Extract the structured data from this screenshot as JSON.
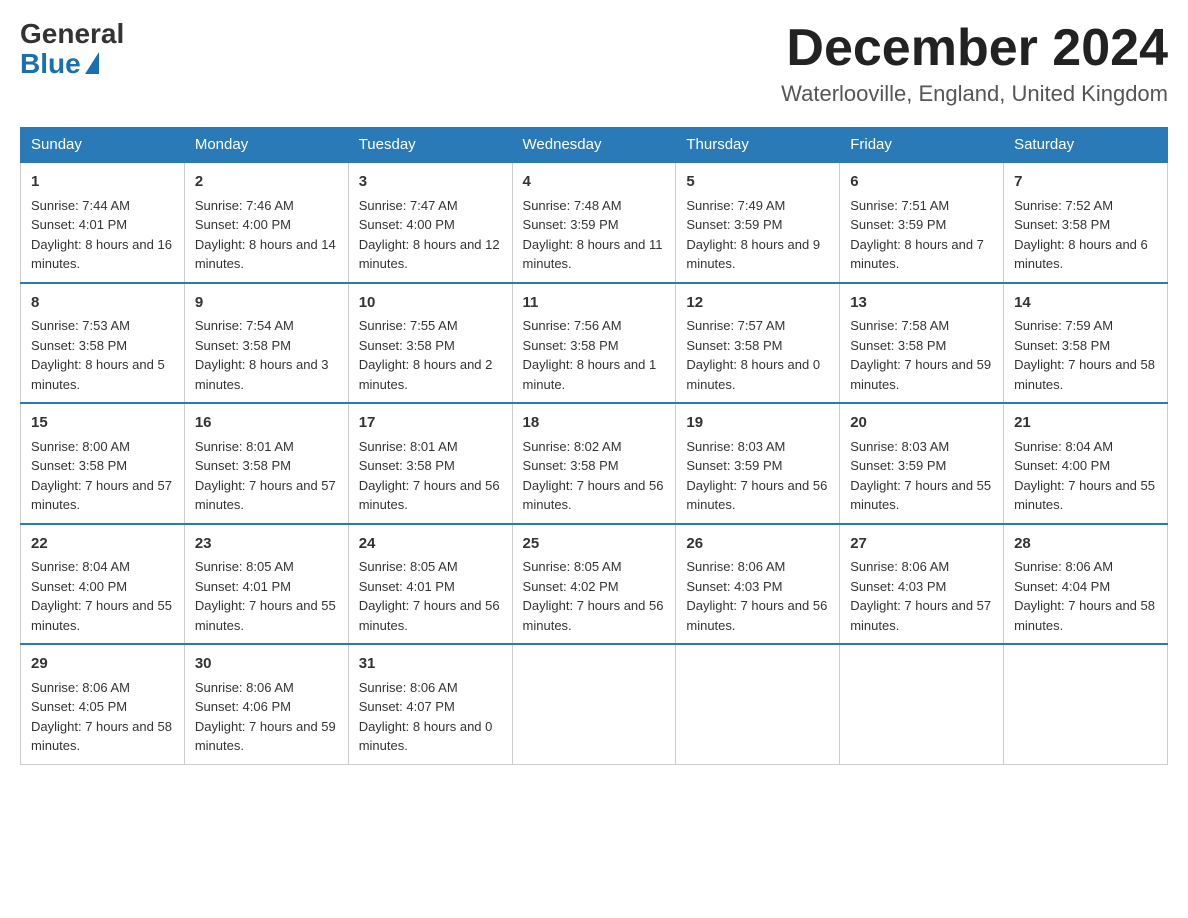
{
  "logo": {
    "general": "General",
    "blue": "Blue"
  },
  "header": {
    "month_year": "December 2024",
    "location": "Waterlooville, England, United Kingdom"
  },
  "days_of_week": [
    "Sunday",
    "Monday",
    "Tuesday",
    "Wednesday",
    "Thursday",
    "Friday",
    "Saturday"
  ],
  "weeks": [
    [
      {
        "day": "1",
        "sunrise": "7:44 AM",
        "sunset": "4:01 PM",
        "daylight": "8 hours and 16 minutes."
      },
      {
        "day": "2",
        "sunrise": "7:46 AM",
        "sunset": "4:00 PM",
        "daylight": "8 hours and 14 minutes."
      },
      {
        "day": "3",
        "sunrise": "7:47 AM",
        "sunset": "4:00 PM",
        "daylight": "8 hours and 12 minutes."
      },
      {
        "day": "4",
        "sunrise": "7:48 AM",
        "sunset": "3:59 PM",
        "daylight": "8 hours and 11 minutes."
      },
      {
        "day": "5",
        "sunrise": "7:49 AM",
        "sunset": "3:59 PM",
        "daylight": "8 hours and 9 minutes."
      },
      {
        "day": "6",
        "sunrise": "7:51 AM",
        "sunset": "3:59 PM",
        "daylight": "8 hours and 7 minutes."
      },
      {
        "day": "7",
        "sunrise": "7:52 AM",
        "sunset": "3:58 PM",
        "daylight": "8 hours and 6 minutes."
      }
    ],
    [
      {
        "day": "8",
        "sunrise": "7:53 AM",
        "sunset": "3:58 PM",
        "daylight": "8 hours and 5 minutes."
      },
      {
        "day": "9",
        "sunrise": "7:54 AM",
        "sunset": "3:58 PM",
        "daylight": "8 hours and 3 minutes."
      },
      {
        "day": "10",
        "sunrise": "7:55 AM",
        "sunset": "3:58 PM",
        "daylight": "8 hours and 2 minutes."
      },
      {
        "day": "11",
        "sunrise": "7:56 AM",
        "sunset": "3:58 PM",
        "daylight": "8 hours and 1 minute."
      },
      {
        "day": "12",
        "sunrise": "7:57 AM",
        "sunset": "3:58 PM",
        "daylight": "8 hours and 0 minutes."
      },
      {
        "day": "13",
        "sunrise": "7:58 AM",
        "sunset": "3:58 PM",
        "daylight": "7 hours and 59 minutes."
      },
      {
        "day": "14",
        "sunrise": "7:59 AM",
        "sunset": "3:58 PM",
        "daylight": "7 hours and 58 minutes."
      }
    ],
    [
      {
        "day": "15",
        "sunrise": "8:00 AM",
        "sunset": "3:58 PM",
        "daylight": "7 hours and 57 minutes."
      },
      {
        "day": "16",
        "sunrise": "8:01 AM",
        "sunset": "3:58 PM",
        "daylight": "7 hours and 57 minutes."
      },
      {
        "day": "17",
        "sunrise": "8:01 AM",
        "sunset": "3:58 PM",
        "daylight": "7 hours and 56 minutes."
      },
      {
        "day": "18",
        "sunrise": "8:02 AM",
        "sunset": "3:58 PM",
        "daylight": "7 hours and 56 minutes."
      },
      {
        "day": "19",
        "sunrise": "8:03 AM",
        "sunset": "3:59 PM",
        "daylight": "7 hours and 56 minutes."
      },
      {
        "day": "20",
        "sunrise": "8:03 AM",
        "sunset": "3:59 PM",
        "daylight": "7 hours and 55 minutes."
      },
      {
        "day": "21",
        "sunrise": "8:04 AM",
        "sunset": "4:00 PM",
        "daylight": "7 hours and 55 minutes."
      }
    ],
    [
      {
        "day": "22",
        "sunrise": "8:04 AM",
        "sunset": "4:00 PM",
        "daylight": "7 hours and 55 minutes."
      },
      {
        "day": "23",
        "sunrise": "8:05 AM",
        "sunset": "4:01 PM",
        "daylight": "7 hours and 55 minutes."
      },
      {
        "day": "24",
        "sunrise": "8:05 AM",
        "sunset": "4:01 PM",
        "daylight": "7 hours and 56 minutes."
      },
      {
        "day": "25",
        "sunrise": "8:05 AM",
        "sunset": "4:02 PM",
        "daylight": "7 hours and 56 minutes."
      },
      {
        "day": "26",
        "sunrise": "8:06 AM",
        "sunset": "4:03 PM",
        "daylight": "7 hours and 56 minutes."
      },
      {
        "day": "27",
        "sunrise": "8:06 AM",
        "sunset": "4:03 PM",
        "daylight": "7 hours and 57 minutes."
      },
      {
        "day": "28",
        "sunrise": "8:06 AM",
        "sunset": "4:04 PM",
        "daylight": "7 hours and 58 minutes."
      }
    ],
    [
      {
        "day": "29",
        "sunrise": "8:06 AM",
        "sunset": "4:05 PM",
        "daylight": "7 hours and 58 minutes."
      },
      {
        "day": "30",
        "sunrise": "8:06 AM",
        "sunset": "4:06 PM",
        "daylight": "7 hours and 59 minutes."
      },
      {
        "day": "31",
        "sunrise": "8:06 AM",
        "sunset": "4:07 PM",
        "daylight": "8 hours and 0 minutes."
      },
      null,
      null,
      null,
      null
    ]
  ]
}
